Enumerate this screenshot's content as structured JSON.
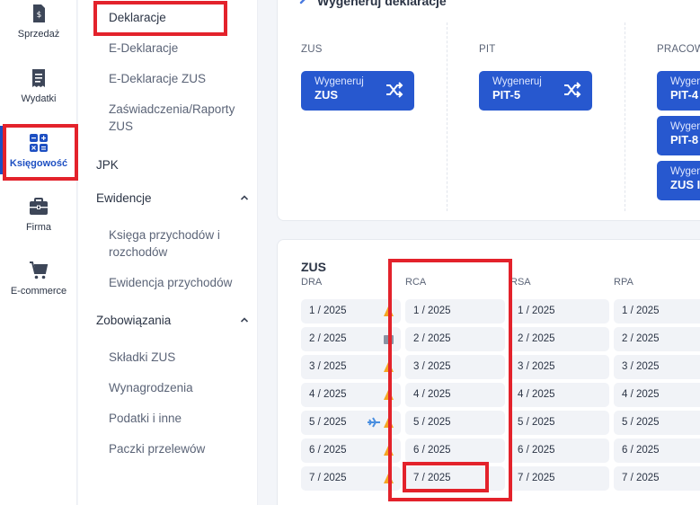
{
  "rail": {
    "items": [
      {
        "label": "Sprzedaż",
        "icon": "invoice-dollar-icon"
      },
      {
        "label": "Wydatki",
        "icon": "receipt-icon"
      },
      {
        "label": "Księgowość",
        "icon": "calculator-icon",
        "active": true
      },
      {
        "label": "Firma",
        "icon": "briefcase-icon"
      },
      {
        "label": "E-commerce",
        "icon": "cart-icon"
      }
    ]
  },
  "subnav": {
    "links_top": [
      "Deklaracje",
      "E-Deklaracje",
      "E-Deklaracje ZUS",
      "Zaświadczenia/Raporty ZUS"
    ],
    "jpk": "JPK",
    "ewidencje": {
      "label": "Ewidencje",
      "items": [
        "Księga przychodów i rozchodów",
        "Ewidencja przychodów"
      ]
    },
    "zobowiazania": {
      "label": "Zobowiązania",
      "items": [
        "Składki ZUS",
        "Wynagrodzenia",
        "Podatki i inne",
        "Paczki przelewów"
      ]
    }
  },
  "generate": {
    "title": "Wygeneruj deklaracje",
    "columns": [
      {
        "label": "ZUS",
        "buttons": [
          {
            "line1": "Wygeneruj",
            "line2": "ZUS"
          }
        ]
      },
      {
        "label": "PIT",
        "buttons": [
          {
            "line1": "Wygeneruj",
            "line2": "PIT-5"
          }
        ]
      },
      {
        "label": "PRACOW",
        "buttons": [
          {
            "line1": "Wygen",
            "line2": "PIT-4"
          },
          {
            "line1": "Wygen",
            "line2": "PIT-8"
          },
          {
            "line1": "Wygen",
            "line2": "ZUS I"
          }
        ]
      }
    ]
  },
  "zus": {
    "title": "ZUS",
    "columns": [
      {
        "label": "DRA",
        "rows": [
          "1 / 2025",
          "2 / 2025",
          "3 / 2025",
          "4 / 2025",
          "5 / 2025",
          "6 / 2025",
          "7 / 2025"
        ]
      },
      {
        "label": "RCA",
        "rows": [
          "1 / 2025",
          "2 / 2025",
          "3 / 2025",
          "4 / 2025",
          "5 / 2025",
          "6 / 2025",
          "7 / 2025"
        ]
      },
      {
        "label": "RSA",
        "rows": [
          "1 / 2025",
          "2 / 2025",
          "3 / 2025",
          "4 / 2025",
          "5 / 2025",
          "6 / 2025",
          "7 / 2025"
        ]
      },
      {
        "label": "RPA",
        "rows": [
          "1 / 2025",
          "2 / 2025",
          "3 / 2025",
          "4 / 2025",
          "5 / 2025",
          "6 / 2025",
          "7 / 2025"
        ]
      }
    ],
    "dra_indicators": [
      "warning-icon",
      "lock-icon",
      "warning-icon",
      "warning-icon",
      "plane-warning-icon",
      "warning-icon",
      "warning-icon"
    ]
  },
  "colors": {
    "accent": "#2758cf",
    "highlight": "#e3222b",
    "warning": "#f5a623"
  }
}
